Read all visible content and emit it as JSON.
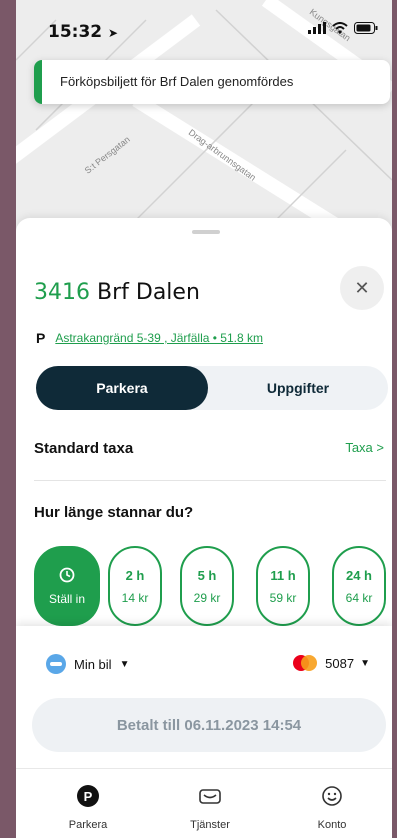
{
  "status_bar": {
    "time": "15:32"
  },
  "map": {
    "street_labels": [
      "S:t Persgatan",
      "Drag-arbrunnsgatan",
      "Kungsgatan"
    ]
  },
  "toast": {
    "message": "Förköpsbiljett för Brf Dalen genomfördes"
  },
  "zone": {
    "number": "3416",
    "name": "Brf Dalen",
    "p_label": "P",
    "address": "Astrakangränd 5-39 , Järfälla • 51.8 km"
  },
  "segment": {
    "active": "Parkera",
    "inactive": "Uppgifter"
  },
  "rate": {
    "label": "Standard taxa",
    "link": "Taxa >"
  },
  "duration": {
    "question": "Hur länge stannar du?",
    "set_label": "Ställ in",
    "options": [
      {
        "hours": "2 h",
        "price": "14 kr"
      },
      {
        "hours": "5 h",
        "price": "29 kr"
      },
      {
        "hours": "11 h",
        "price": "59 kr"
      },
      {
        "hours": "24 h",
        "price": "64 kr"
      }
    ]
  },
  "vehicle": {
    "label": "Min bil"
  },
  "payment": {
    "card_last4": "5087"
  },
  "paid_button": {
    "label": "Betalt till 06.11.2023 14:54"
  },
  "tabs": [
    {
      "label": "Parkera"
    },
    {
      "label": "Tjänster"
    },
    {
      "label": "Konto"
    }
  ],
  "colors": {
    "brand_green": "#1f9e4d",
    "navy": "#0f2a38"
  }
}
